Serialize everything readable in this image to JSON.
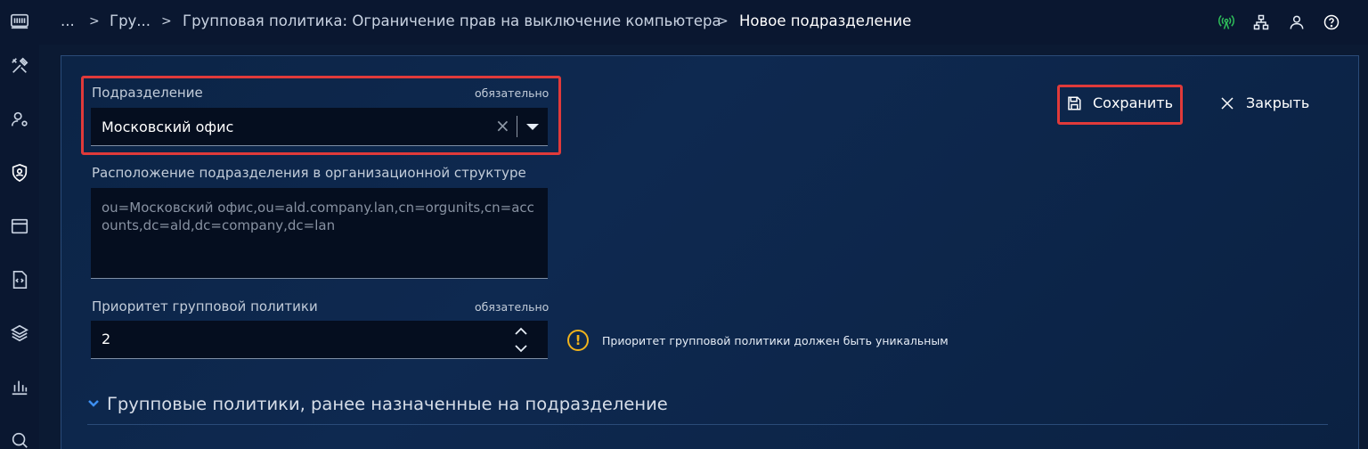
{
  "breadcrumb": {
    "ellipsis": "...",
    "item1": "Гру...",
    "item2": "Групповая политика: Ограничение прав на выключение компьютера",
    "current": "Новое подразделение",
    "separator": ">"
  },
  "sidebar": {
    "icons": [
      "app-logo-icon",
      "tools-icon",
      "user-settings-icon",
      "user-shield-icon",
      "window-icon",
      "code-file-icon",
      "layers-icon",
      "bar-chart-icon",
      "search-icon"
    ]
  },
  "top_icons": [
    "signal-icon",
    "network-icon",
    "user-icon",
    "help-icon"
  ],
  "form": {
    "subdivision": {
      "label": "Подразделение",
      "required": "обязательно",
      "value": "Московский офис",
      "clear": "×"
    },
    "location": {
      "label": "Расположение подразделения в организационной структуре",
      "value": "ou=Московский офис,ou=ald.company.lan,cn=orgunits,cn=accounts,dc=ald,dc=company,dc=lan"
    },
    "priority": {
      "label": "Приоритет групповой политики",
      "required": "обязательно",
      "value": "2",
      "up": "⌃",
      "down": "⌄",
      "hint_icon": "!",
      "hint": "Приоритет групповой политики должен быть уникальным"
    }
  },
  "actions": {
    "save_label": "Сохранить",
    "close_label": "Закрыть"
  },
  "section": {
    "title": "Групповые политики, ранее назначенные на подразделение"
  },
  "colors": {
    "highlight": "#e03a3a",
    "accent_blue": "#3d8ff0",
    "warning": "#f0b31c",
    "signal_green": "#2fbf5a"
  }
}
